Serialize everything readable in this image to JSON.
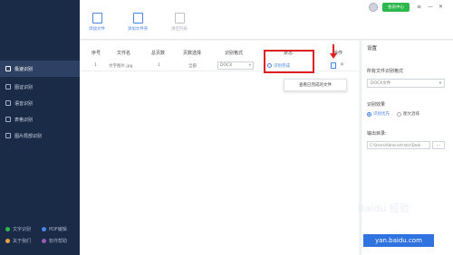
{
  "header": {
    "buttons": [
      {
        "label": "添加文件",
        "icon": "add-file-icon"
      },
      {
        "label": "添加文件夹",
        "icon": "add-folder-icon"
      },
      {
        "label": "清空列表",
        "icon": "clear-list-icon"
      }
    ],
    "member_label": "会员中心"
  },
  "sidebar": {
    "items": [
      {
        "label": "极速识别"
      },
      {
        "label": "图证识别"
      },
      {
        "label": "语音识别"
      },
      {
        "label": "表格识别"
      },
      {
        "label": "图片局部识别"
      }
    ],
    "bottom": [
      {
        "label": "文字识别",
        "color": "#2db84d"
      },
      {
        "label": "PDF编辑",
        "color": "#4a86e8"
      },
      {
        "label": "关于我们",
        "color": "#e8a33d"
      },
      {
        "label": "软件帮助",
        "color": "#9b59b6"
      }
    ]
  },
  "table": {
    "columns": [
      "序号",
      "文件名",
      "总页数",
      "页数选择",
      "识别格式",
      "状态",
      "操作"
    ],
    "rows": [
      {
        "index": "1",
        "filename": "文字图片.jpg",
        "pages": "1",
        "page_select": "全部",
        "format": "DOCX",
        "status": "识别完成"
      }
    ]
  },
  "tooltip": "查看已完成的文件",
  "settings": {
    "title": "设置",
    "format_label": "所有文件识别格式",
    "format_value": "DOCX文件",
    "effect_label": "识别效果",
    "effect_options": [
      "识别优先",
      "图文混排"
    ],
    "output_label": "输出目录:",
    "output_path": "C:\\Users\\Administrator\\Desk",
    "browse_label": "..."
  },
  "watermark": {
    "text": "Baidu 经验",
    "tag": "yan.baidu.com"
  },
  "colors": {
    "accent": "#4a86e8",
    "highlight": "#e02020",
    "sidebar_bg": "#1a2b47",
    "member_bg": "#2db84d"
  }
}
